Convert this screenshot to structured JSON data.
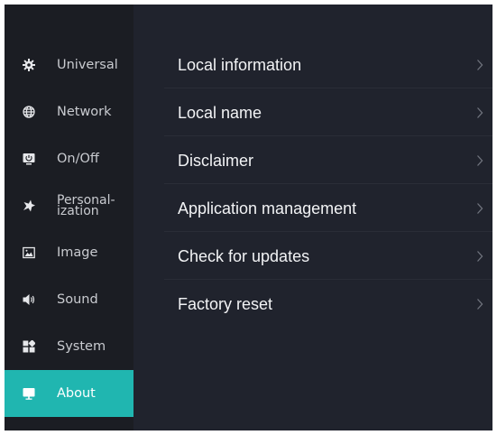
{
  "sidebar": {
    "items": [
      {
        "icon": "gear-icon",
        "label": "Universal"
      },
      {
        "icon": "globe-icon",
        "label": "Network"
      },
      {
        "icon": "power-icon",
        "label": "On/Off"
      },
      {
        "icon": "star-icon",
        "label_line1": "Personal-",
        "label_line2": "ization"
      },
      {
        "icon": "image-icon",
        "label": "Image"
      },
      {
        "icon": "speaker-icon",
        "label": "Sound"
      },
      {
        "icon": "system-icon",
        "label": "System"
      },
      {
        "icon": "monitor-icon",
        "label": "About",
        "active": true
      }
    ]
  },
  "main": {
    "items": [
      {
        "label": "Local information"
      },
      {
        "label": "Local name"
      },
      {
        "label": "Disclaimer"
      },
      {
        "label": "Application management"
      },
      {
        "label": "Check for updates"
      },
      {
        "label": "Factory reset"
      }
    ]
  },
  "colors": {
    "accent": "#20b6b0",
    "sidebar_bg": "#1b1d23",
    "content_bg": "#20232d",
    "text": "#f2f3f5",
    "muted_text": "#c9cbd0",
    "chevron": "#6f737d"
  }
}
